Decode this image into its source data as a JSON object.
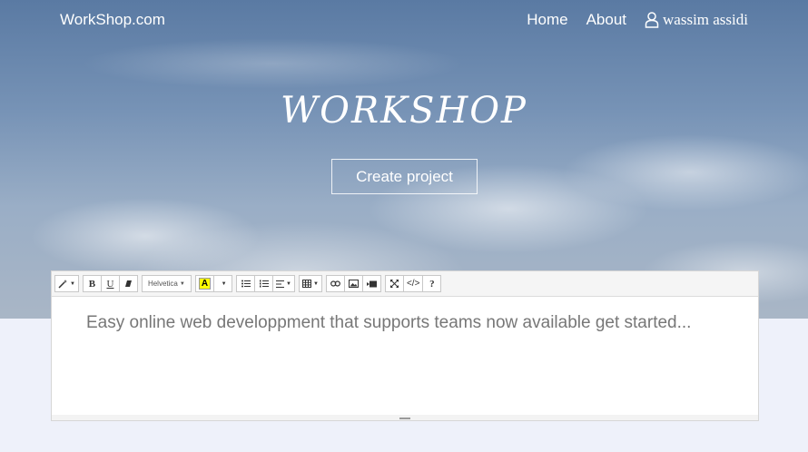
{
  "nav": {
    "brand": "WorkShop.com",
    "links": [
      "Home",
      "About"
    ],
    "user": "wassim assidi"
  },
  "hero": {
    "title": "WORKSHOP",
    "cta": "Create project"
  },
  "editor": {
    "toolbar": {
      "style_icon": "magic-wand-icon",
      "bold": "B",
      "underline": "U",
      "font": "Helvetica",
      "highlight": "A",
      "icons": [
        "eraser-icon",
        "unordered-list-icon",
        "ordered-list-icon",
        "align-icon",
        "table-icon",
        "link-icon",
        "image-icon",
        "video-icon",
        "fullscreen-icon",
        "code-view-icon",
        "help-icon"
      ],
      "code": "</>",
      "help": "?"
    },
    "content": "Easy online web developpment that supports teams now available get started..."
  }
}
